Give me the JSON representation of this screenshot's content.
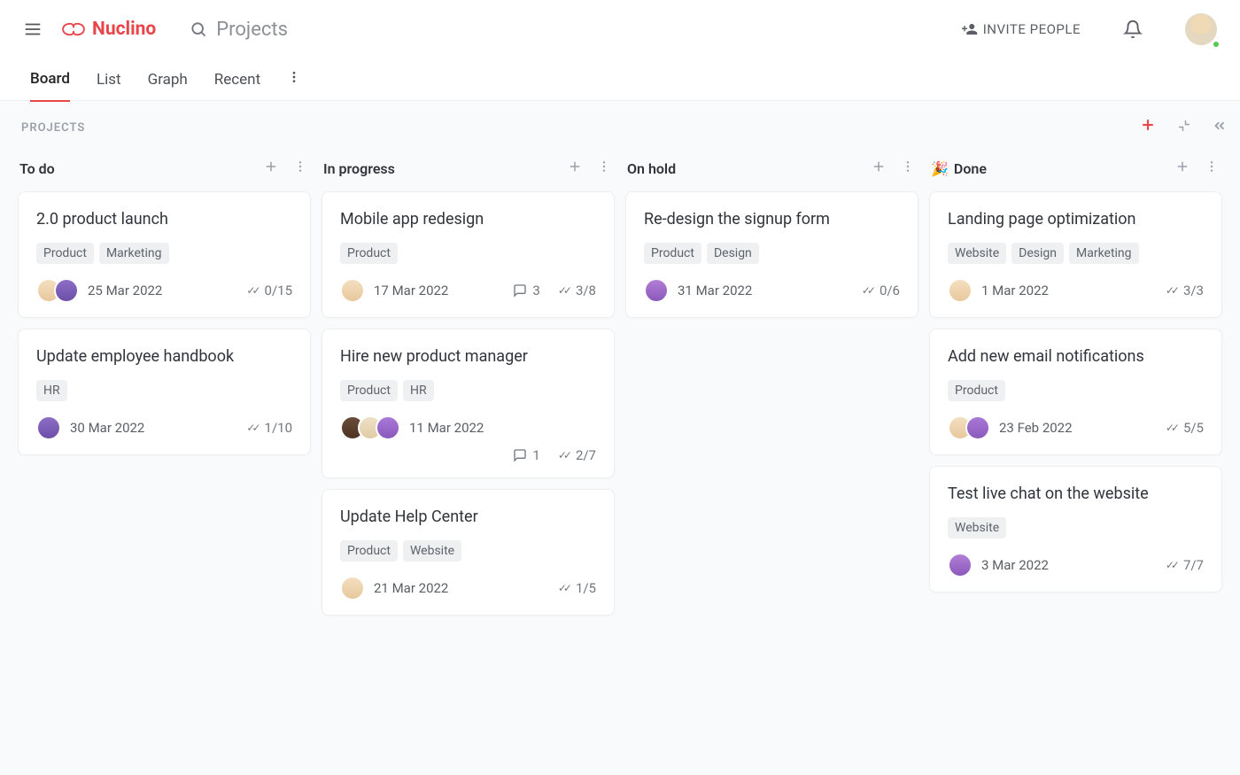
{
  "header": {
    "app_name": "Nuclino",
    "search_placeholder": "Projects",
    "invite_label": "INVITE PEOPLE"
  },
  "tabs": {
    "items": [
      "Board",
      "List",
      "Graph",
      "Recent"
    ],
    "active_index": 0
  },
  "board": {
    "title": "PROJECTS",
    "columns": [
      {
        "id": "todo",
        "title": "To do",
        "emoji": "",
        "cards": [
          {
            "title": "2.0 product launch",
            "tags": [
              "Product",
              "Marketing"
            ],
            "avatars": [
              "av1",
              "av2"
            ],
            "date": "25 Mar 2022",
            "comments": null,
            "checks": "0/15"
          },
          {
            "title": "Update employee handbook",
            "tags": [
              "HR"
            ],
            "avatars": [
              "av2"
            ],
            "date": "30 Mar 2022",
            "comments": null,
            "checks": "1/10"
          }
        ]
      },
      {
        "id": "inprogress",
        "title": "In progress",
        "emoji": "",
        "cards": [
          {
            "title": "Mobile app redesign",
            "tags": [
              "Product"
            ],
            "avatars": [
              "av1"
            ],
            "date": "17 Mar 2022",
            "comments": "3",
            "checks": "3/8"
          },
          {
            "title": "Hire new product manager",
            "tags": [
              "Product",
              "HR"
            ],
            "avatars": [
              "av3",
              "av4",
              "av5"
            ],
            "date": "11 Mar 2022",
            "comments": "1",
            "checks": "2/7"
          },
          {
            "title": "Update Help Center",
            "tags": [
              "Product",
              "Website"
            ],
            "avatars": [
              "av1"
            ],
            "date": "21 Mar 2022",
            "comments": null,
            "checks": "1/5"
          }
        ]
      },
      {
        "id": "onhold",
        "title": "On hold",
        "emoji": "",
        "cards": [
          {
            "title": "Re-design the signup form",
            "tags": [
              "Product",
              "Design"
            ],
            "avatars": [
              "av6"
            ],
            "date": "31 Mar 2022",
            "comments": null,
            "checks": "0/6"
          }
        ]
      },
      {
        "id": "done",
        "title": "Done",
        "emoji": "🎉",
        "cards": [
          {
            "title": "Landing page optimization",
            "tags": [
              "Website",
              "Design",
              "Marketing"
            ],
            "avatars": [
              "av1"
            ],
            "date": "1 Mar 2022",
            "comments": null,
            "checks": "3/3"
          },
          {
            "title": "Add new email notifications",
            "tags": [
              "Product"
            ],
            "avatars": [
              "av1",
              "av5"
            ],
            "date": "23 Feb 2022",
            "comments": null,
            "checks": "5/5"
          },
          {
            "title": "Test live chat on the website",
            "tags": [
              "Website"
            ],
            "avatars": [
              "av6"
            ],
            "date": "3 Mar 2022",
            "comments": null,
            "checks": "7/7"
          }
        ]
      }
    ]
  }
}
